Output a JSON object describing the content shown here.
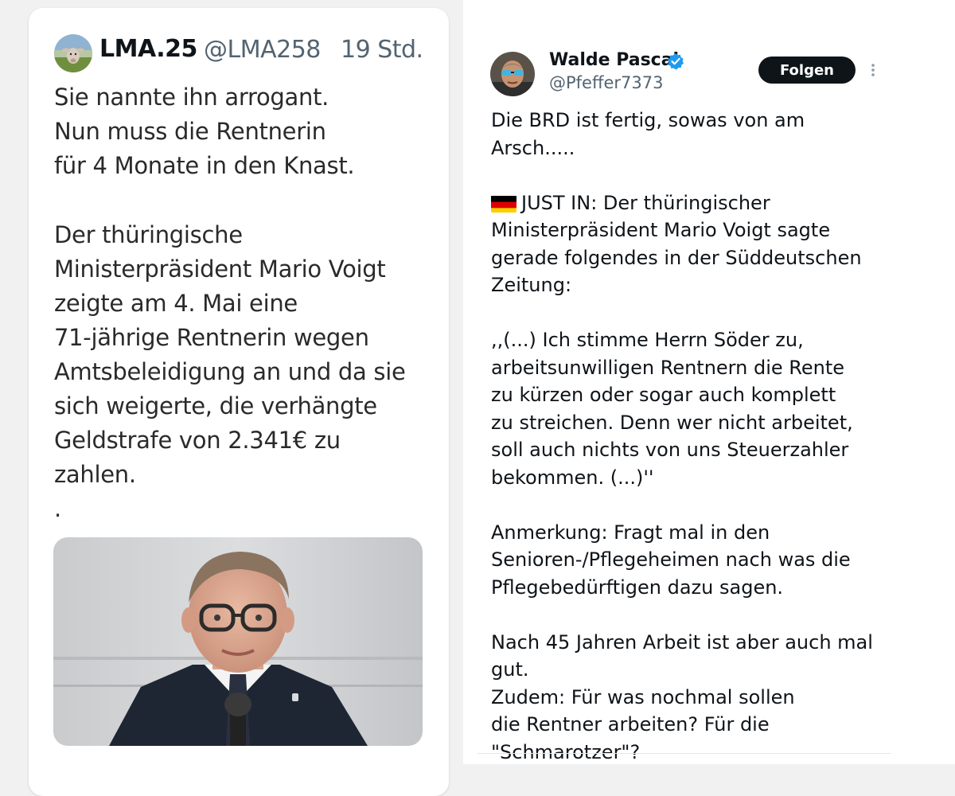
{
  "left_tweet": {
    "author_name": "LMA.25",
    "handle": "@LMA258",
    "time": "19 Std.",
    "lines": [
      "Sie nannte ihn arrogant.",
      "Nun muss die Rentnerin",
      "für 4 Monate in den Knast.",
      "",
      "Der thüringische",
      "Ministerpräsident Mario Voigt",
      "zeigte am 4. Mai eine",
      "71-jährige Rentnerin wegen",
      "Amtsbeleidigung an und da sie",
      "sich weigerte, die verhängte",
      "Geldstrafe von 2.341€ zu",
      "zahlen.",
      "."
    ]
  },
  "right_tweet": {
    "author_name": "Walde Pascal",
    "handle": "@Pfeffer7373",
    "follow_label": "Folgen",
    "lines": [
      "Die BRD ist fertig, sowas von am",
      "Arsch.....",
      "",
      "JUST IN: Der thüringischer",
      "Ministerpräsident Mario Voigt sagte",
      "gerade folgendes in der Süddeutschen",
      "Zeitung:",
      "",
      ",,(...) Ich stimme Herrn Söder zu,",
      "arbeitsunwilligen Rentnern die Rente",
      "zu kürzen oder sogar auch komplett",
      "zu streichen. Denn wer nicht arbeitet,",
      "soll auch nichts von uns Steuerzahler",
      "bekommen. (...)''",
      "",
      "Anmerkung: Fragt mal in den",
      "Senioren-/Pflegeheimen nach was die",
      "Pflegebedürftigen dazu sagen.",
      "",
      "Nach 45 Jahren Arbeit ist aber auch mal",
      "gut.",
      "Zudem: Für was nochmal sollen",
      "die Rentner arbeiten? Für die",
      "\"Schmarotzer\"?"
    ]
  },
  "icons": {
    "verified": "verified-badge-icon",
    "more": "more-vertical-icon",
    "flag": "germany-flag-icon"
  },
  "colors": {
    "follow_button_bg": "#0f1419",
    "verified_blue": "#1d9bf0",
    "secondary_text": "#536471"
  }
}
